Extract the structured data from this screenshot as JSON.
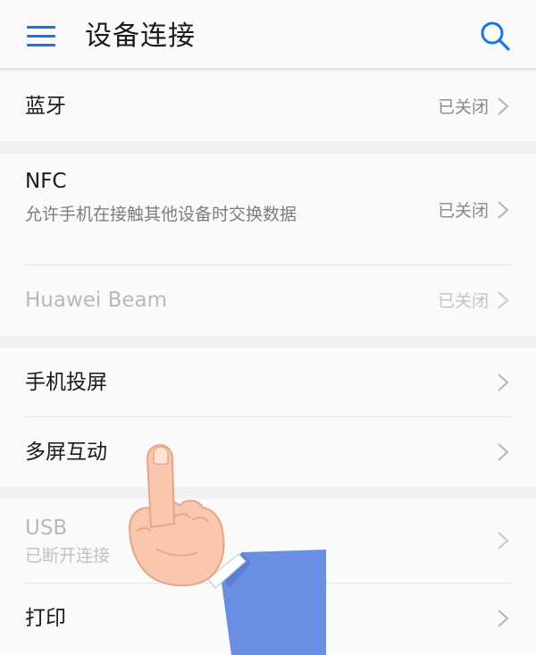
{
  "header": {
    "title": "设备连接",
    "menu_icon": "menu-icon",
    "search_icon": "search-icon",
    "accent_color": "#1a75e0"
  },
  "sections": {
    "bluetooth": {
      "title": "蓝牙",
      "status": "已关闭"
    },
    "nfc": {
      "title": "NFC",
      "subtitle": "允许手机在接触其他设备时交换数据",
      "status": "已关闭"
    },
    "huawei_beam": {
      "title": "Huawei Beam",
      "status": "已关闭"
    },
    "screen_projection": {
      "title": "手机投屏"
    },
    "multi_screen": {
      "title": "多屏互动"
    },
    "usb": {
      "title": "USB",
      "subtitle": "已断开连接"
    },
    "print": {
      "title": "打印"
    }
  },
  "overlay": {
    "icon": "pointing-hand-icon"
  }
}
